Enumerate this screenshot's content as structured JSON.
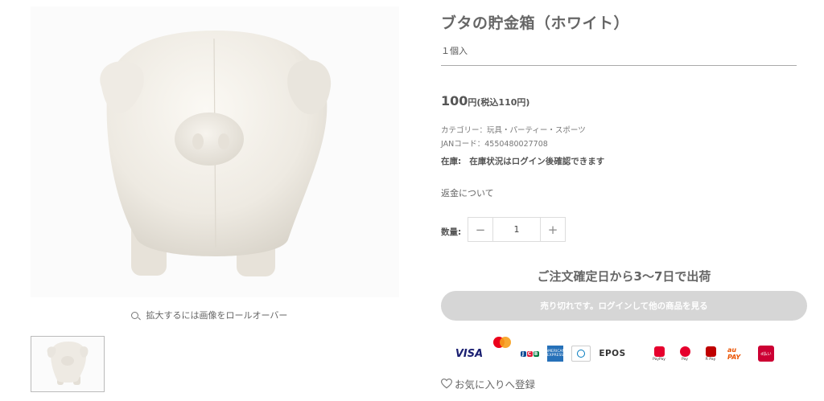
{
  "product": {
    "title": "ブタの貯金箱（ホワイト）",
    "unit": "１個入",
    "price_amount": "100",
    "price_suffix": "円(税込110円)",
    "category": "カテゴリー：玩具・パーティー・スポーツ",
    "jan": "JANコード：4550480027708",
    "stock_label": "在庫:",
    "stock_value": "在庫状況はログイン後確認できます",
    "refund_link": "返金について",
    "qty_label": "数量:",
    "qty_value": "1",
    "shipping": "ご注文確定日から3〜7日で出荷",
    "soldout_button": "売り切れです。ログインして他の商品を見る",
    "favorite": "お気に入りへ登録"
  },
  "gallery": {
    "zoom_hint": "拡大するには画像をロールオーバー"
  },
  "stepper": {
    "minus": "−",
    "plus": "+"
  },
  "payments": [
    {
      "name": "visa",
      "label": "VISA"
    },
    {
      "name": "mastercard",
      "label": ""
    },
    {
      "name": "jcb",
      "label": "JCB"
    },
    {
      "name": "amex",
      "label": "AMERICAN EXPRESS"
    },
    {
      "name": "diners",
      "label": "Diners Club"
    },
    {
      "name": "epos",
      "label": "EPOS"
    },
    {
      "name": "paypay",
      "label": "PayPay"
    },
    {
      "name": "merpay",
      "label": "Pay"
    },
    {
      "name": "rakuten-pay",
      "label": "R Pay"
    },
    {
      "name": "au-pay",
      "label": "au PAY"
    },
    {
      "name": "d-barai",
      "label": "d払い"
    }
  ]
}
